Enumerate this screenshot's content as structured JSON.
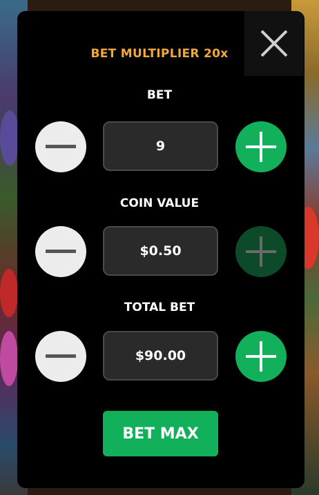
{
  "dialog": {
    "title": "BET MULTIPLIER 20x"
  },
  "bet": {
    "label": "BET",
    "value": "9"
  },
  "coin_value": {
    "label": "COIN VALUE",
    "value": "$0.50",
    "plus_enabled": false
  },
  "total_bet": {
    "label": "TOTAL BET",
    "value": "$90.00"
  },
  "bet_max_label": "BET MAX",
  "colors": {
    "title": "#f3a93a",
    "plus": "#12b05a",
    "plus_disabled": "#0c4a2a",
    "minus": "#ececec"
  },
  "icons": [
    "close-icon",
    "minus-icon",
    "plus-icon"
  ]
}
